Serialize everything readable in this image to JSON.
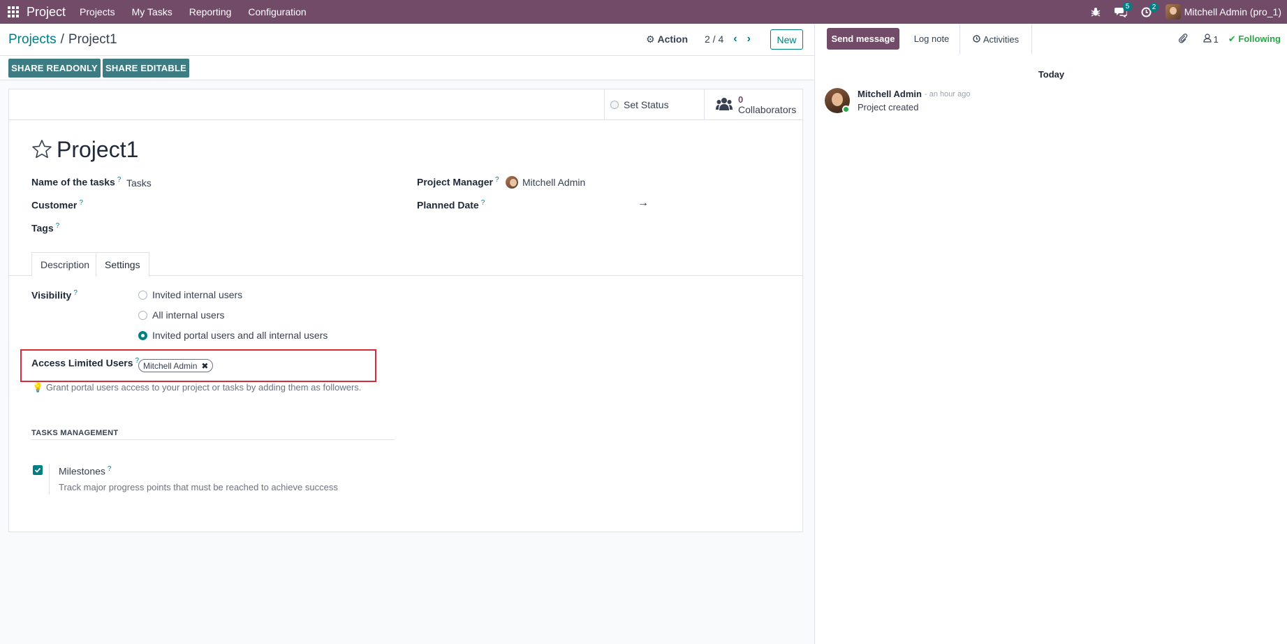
{
  "navbar": {
    "app_name": "Project",
    "menu": [
      "Projects",
      "My Tasks",
      "Reporting",
      "Configuration"
    ],
    "messages_count": "5",
    "activities_count": "2",
    "user": "Mitchell Admin (pro_1)"
  },
  "control_panel": {
    "breadcrumb_parent": "Projects",
    "breadcrumb_separator": "/",
    "breadcrumb_current": "Project1",
    "action_label": "Action",
    "pager": "2 / 4",
    "new_label": "New"
  },
  "share": {
    "readonly_label": "SHARE READONLY",
    "editable_label": "SHARE EDITABLE"
  },
  "statusbar": {
    "set_status": "Set Status",
    "collaborators_count": "0",
    "collaborators_label": "Collaborators"
  },
  "form": {
    "title": "Project1",
    "name_of_tasks_label": "Name of the tasks",
    "name_of_tasks_value": "Tasks",
    "customer_label": "Customer",
    "tags_label": "Tags",
    "project_manager_label": "Project Manager",
    "project_manager_value": "Mitchell Admin",
    "planned_date_label": "Planned Date",
    "planned_date_arrow": "→",
    "help_mark": "?"
  },
  "tabs": [
    "Description",
    "Settings"
  ],
  "settings": {
    "visibility_label": "Visibility",
    "visibility_options": [
      {
        "label": "Invited internal users",
        "checked": false
      },
      {
        "label": "All internal users",
        "checked": false
      },
      {
        "label": "Invited portal users and all internal users",
        "checked": true
      }
    ],
    "access_limited_label": "Access Limited Users",
    "access_limited_tag": "Mitchell Admin",
    "access_hint": "Grant portal users access to your project or tasks by adding them as followers.",
    "section_title": "TASKS MANAGEMENT",
    "milestones_label": "Milestones",
    "milestones_checked": true,
    "milestones_desc": "Track major progress points that must be reached to achieve success"
  },
  "chatter": {
    "send_message": "Send message",
    "log_note": "Log note",
    "activities": "Activities",
    "followers_count": "1",
    "following": "Following",
    "date_separator": "Today",
    "message_author": "Mitchell Admin",
    "message_time": "- an hour ago",
    "message_body": "Project created"
  },
  "colors": {
    "brand": "#714b67",
    "accent": "#017e84",
    "highlight": "#d72a3c",
    "following": "#28a745"
  }
}
